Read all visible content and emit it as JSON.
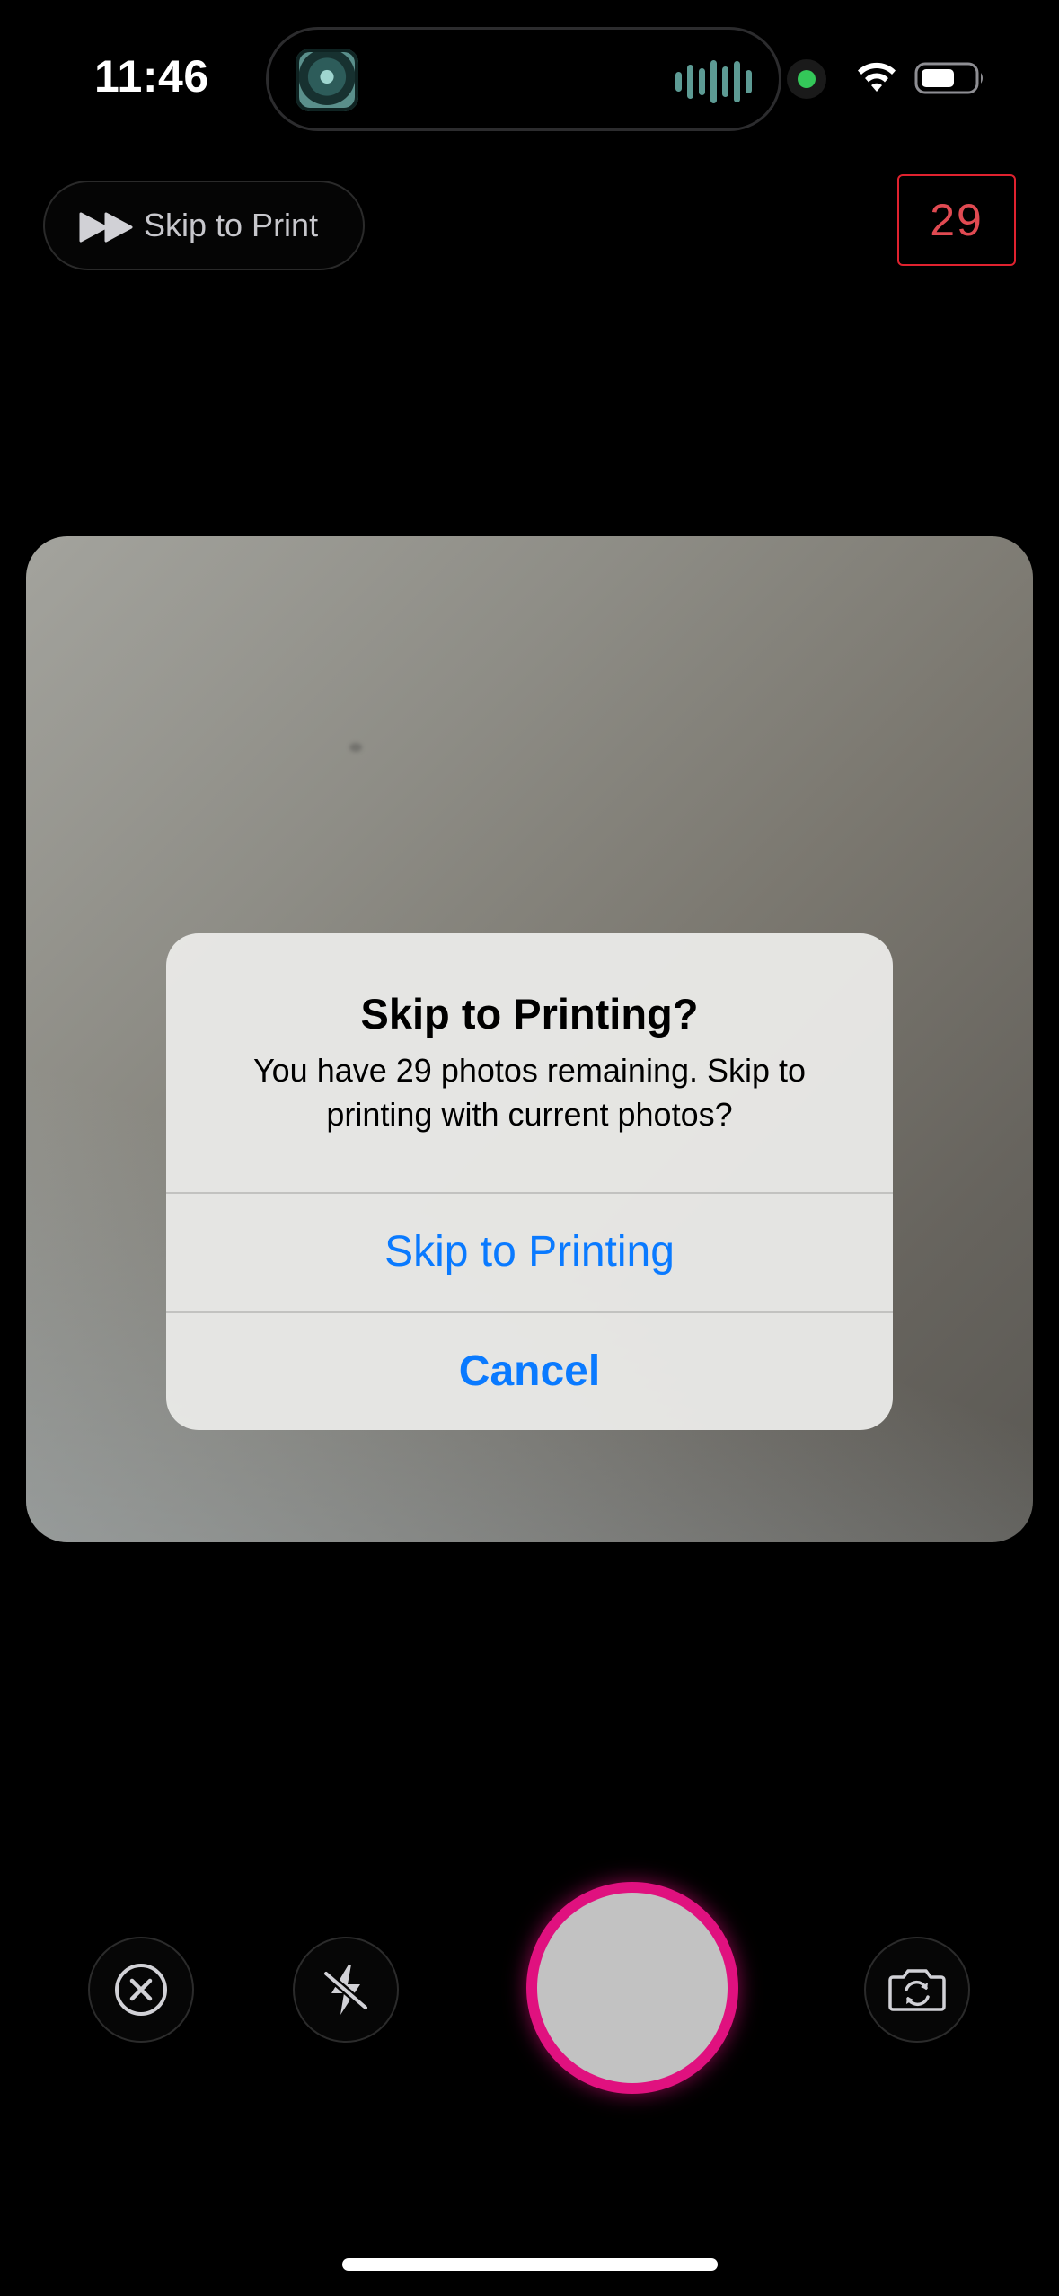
{
  "status_bar": {
    "time": "11:46",
    "icons": [
      "live-activity-app-icon",
      "audio-waveform-icon",
      "camera-in-use-indicator",
      "wifi-icon",
      "battery-icon"
    ],
    "indicator_color": "#34c759"
  },
  "top_bar": {
    "skip_label": "Skip to Print",
    "skip_icon": "fast-forward-icon",
    "photos_remaining": "29",
    "counter_color": "#e0222f"
  },
  "alert": {
    "title": "Skip to Printing?",
    "message": "You have 29 photos remaining. Skip to printing with current photos?",
    "confirm_label": "Skip to Printing",
    "cancel_label": "Cancel",
    "button_color": "#0a7aff"
  },
  "bottom_controls": {
    "icons": [
      "close-circle-icon",
      "flash-off-icon",
      "shutter-button",
      "switch-camera-icon"
    ],
    "shutter_ring_color": "#e0117f"
  }
}
